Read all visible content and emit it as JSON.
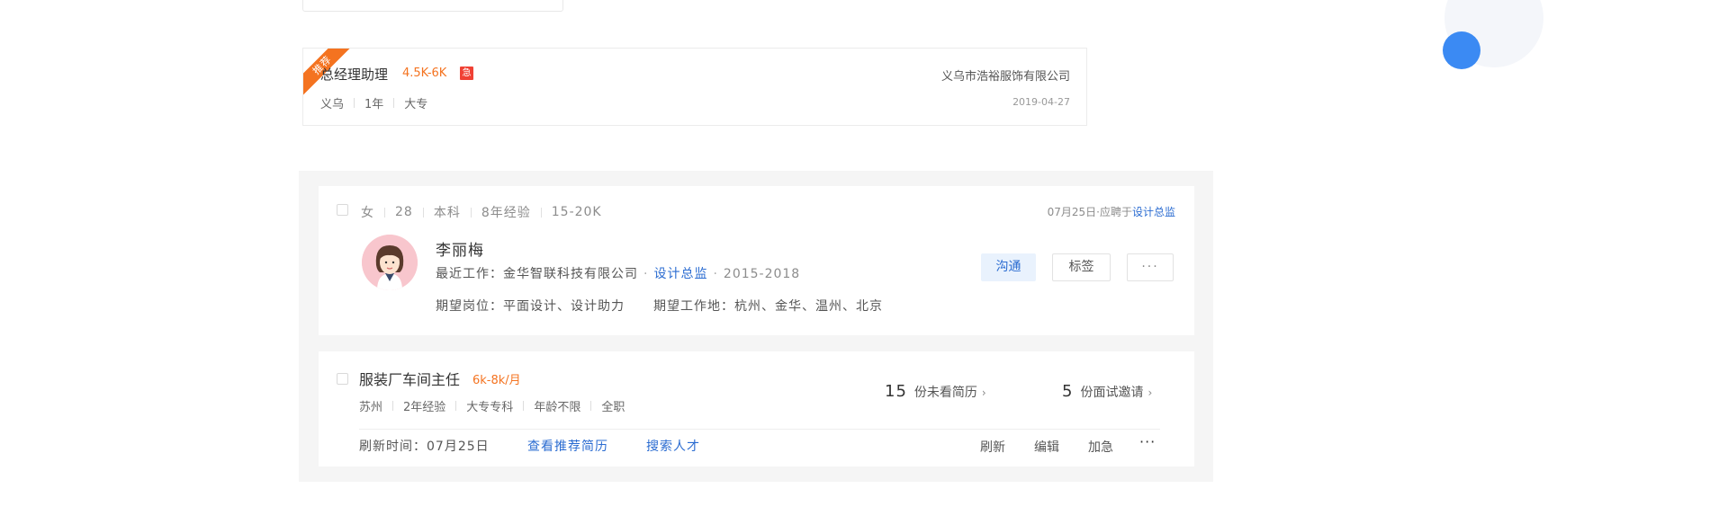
{
  "top_job": {
    "ribbon": "推荐",
    "title": "总经理助理",
    "salary": "4.5K-6K",
    "urgent": "急",
    "company": "义乌市浩裕服饰有限公司",
    "meta": [
      "义乌",
      "1年",
      "大专"
    ],
    "date": "2019-04-27"
  },
  "candidate": {
    "meta": [
      "女",
      "28",
      "本科",
      "8年经验",
      "15-20K"
    ],
    "applied_prefix": "07月25日·应聘于",
    "applied_position": "设计总监",
    "name": "李丽梅",
    "recent_label": "最近工作：金华智联科技有限公司",
    "recent_position": "设计总监",
    "recent_years": "2015-2018",
    "expect_position": "期望岗位：平面设计、设计助力",
    "expect_location": "期望工作地：杭州、金华、温州、北京",
    "buttons": {
      "chat": "沟通",
      "tag": "标签",
      "more": "···"
    }
  },
  "posting": {
    "title": "服装厂车间主任",
    "salary": "6k-8k/月",
    "meta": [
      "苏州",
      "2年经验",
      "大专专科",
      "年龄不限",
      "全职"
    ],
    "unread_count": "15",
    "unread_label": "份未看简历",
    "interview_count": "5",
    "interview_label": "份面试邀请",
    "refresh_time": "刷新时间：07月25日",
    "link_recommended": "查看推荐简历",
    "link_search": "搜索人才",
    "actions": {
      "refresh": "刷新",
      "edit": "编辑",
      "boost": "加急",
      "more": "···"
    }
  },
  "colors": {
    "accent": "#2b6cd1",
    "salary": "#f47320",
    "urgent": "#f04134",
    "deco_dot": "#3b8af3"
  }
}
